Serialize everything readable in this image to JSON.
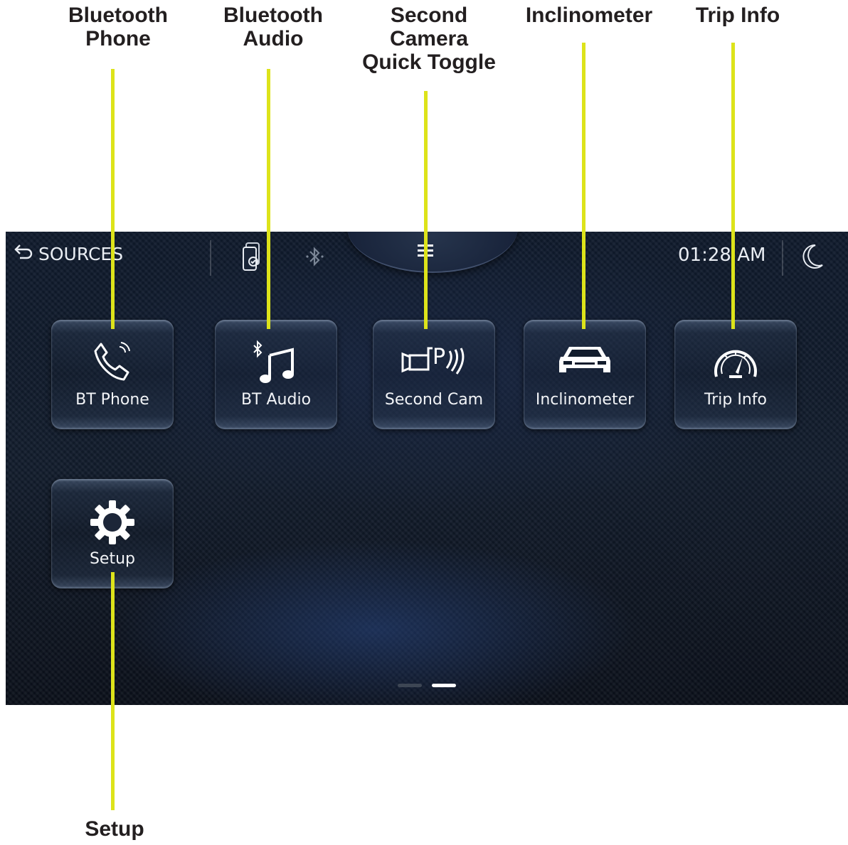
{
  "callouts": {
    "bt_phone": "Bluetooth\nPhone",
    "bt_audio": "Bluetooth\nAudio",
    "second_camera": "Second\nCamera\nQuick Toggle",
    "inclinometer": "Inclinometer",
    "trip_info": "Trip Info",
    "setup": "Setup"
  },
  "statusbar": {
    "sources_label": "SOURCES",
    "time": "01:28 AM",
    "icons": [
      "back-arrow-icon",
      "phone-connected-icon",
      "bluetooth-icon",
      "menu-icon",
      "moon-icon"
    ]
  },
  "tiles": [
    {
      "label": "BT Phone",
      "icon": "phone-call-icon"
    },
    {
      "label": "BT Audio",
      "icon": "bluetooth-music-icon"
    },
    {
      "label": "Second Cam",
      "icon": "camera-park-icon"
    },
    {
      "label": "Inclinometer",
      "icon": "car-icon"
    },
    {
      "label": "Trip Info",
      "icon": "speedometer-icon"
    },
    {
      "label": "Setup",
      "icon": "gear-icon"
    }
  ],
  "pagination": {
    "pages": 2,
    "current": 2
  },
  "colors": {
    "leader": "#dde31a",
    "callout_text": "#231f20",
    "screen_bg": "#121c2c",
    "text": "#e9edf3"
  }
}
